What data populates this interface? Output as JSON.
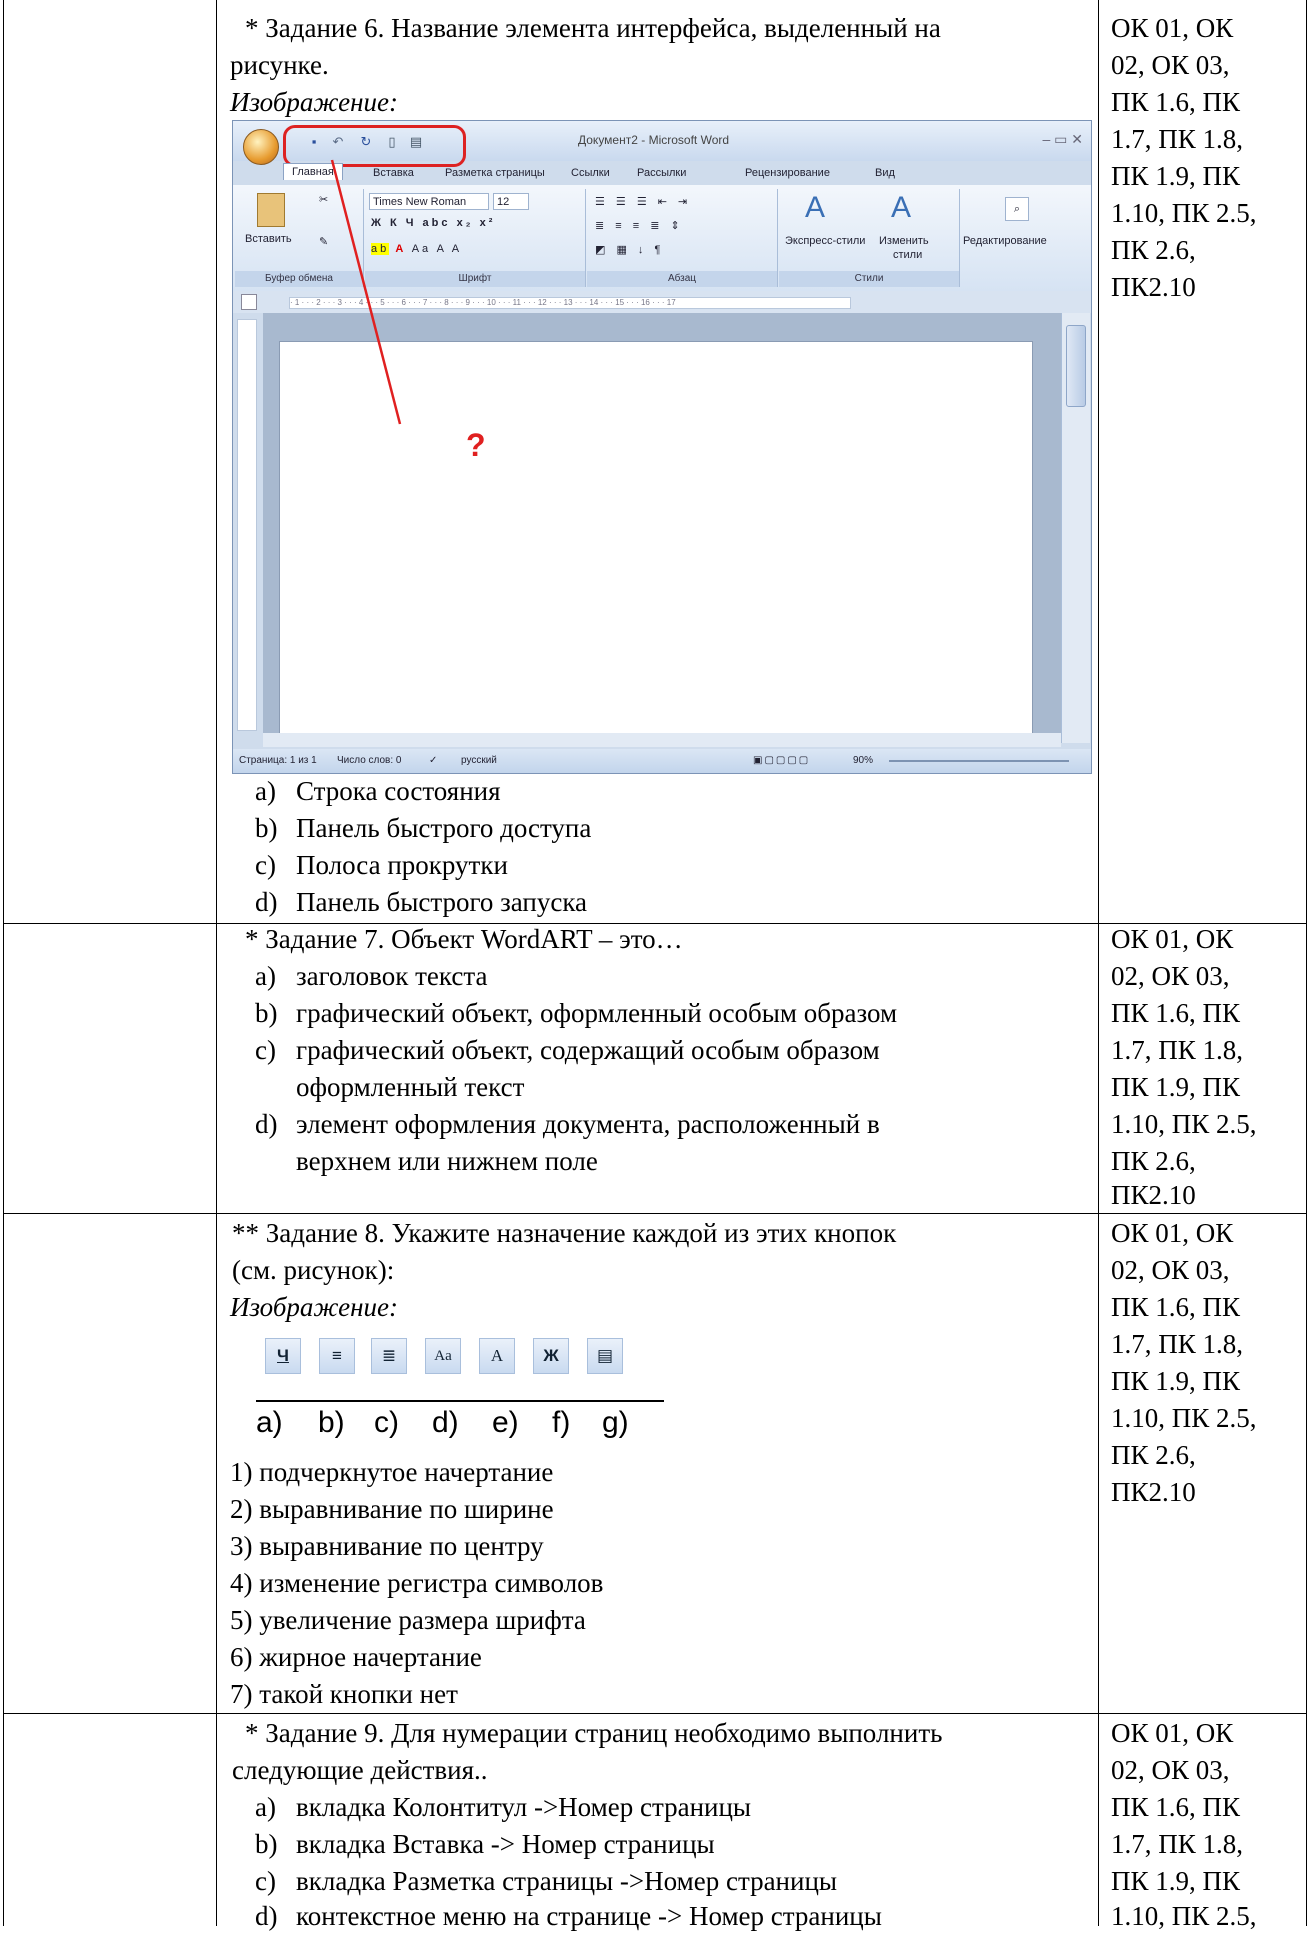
{
  "task6": {
    "question_line1": "* Задание 6. Название элемента интерфейса, выделенный на",
    "question_line2": "рисунке.",
    "image_label": "Изображение:",
    "word": {
      "window_title": "Документ2 - Microsoft Word",
      "tabs": [
        "Главная",
        "Вставка",
        "Разметка страницы",
        "Ссылки",
        "Рассылки",
        "Рецензирование",
        "Вид"
      ],
      "groups": [
        "Буфер обмена",
        "Шрифт",
        "Абзац",
        "Стили",
        "Редактирование"
      ],
      "paste_label": "Вставить",
      "font_name": "Times New Roman",
      "font_size": "12",
      "styles_label1": "Экспресс-стили",
      "styles_label2": "Изменить",
      "styles_label3": "стили",
      "status_page": "Страница: 1 из 1",
      "status_words": "Число слов: 0",
      "status_lang": "русский",
      "zoom": "90%",
      "question_mark": "?"
    },
    "options": [
      {
        "letter": "a)",
        "text": "Строка состояния"
      },
      {
        "letter": "b)",
        "text": "Панель быстрого доступа"
      },
      {
        "letter": "c)",
        "text": "Полоса прокрутки"
      },
      {
        "letter": "d)",
        "text": "Панель быстрого запуска"
      }
    ]
  },
  "task7": {
    "question": "* Задание 7. Объект WordART – это…",
    "options": [
      {
        "letter": "a)",
        "lines": [
          "заголовок текста"
        ]
      },
      {
        "letter": "b)",
        "lines": [
          "графический объект, оформленный особым образом"
        ]
      },
      {
        "letter": "c)",
        "lines": [
          "графический объект, содержащий особым образом",
          "оформленный текст"
        ]
      },
      {
        "letter": "d)",
        "lines": [
          "элемент оформления документа, расположенный в",
          "верхнем или нижнем поле"
        ]
      }
    ]
  },
  "task8": {
    "question_line1": "** Задание 8. Укажите назначение каждой из этих кнопок",
    "question_line2": "(см. рисунок):",
    "image_label": "Изображение:",
    "buttons": [
      "Ч",
      "≡",
      "≣",
      "Aa",
      "A",
      "Ж",
      "▤"
    ],
    "button_letters": [
      "a)",
      "b)",
      "c)",
      "d)",
      "e)",
      "f)",
      "g)"
    ],
    "answers": [
      "1) подчеркнутое начертание",
      "2) выравнивание по ширине",
      "3) выравнивание по центру",
      "4) изменение регистра символов",
      "5) увеличение размера шрифта",
      "6) жирное начертание",
      "7) такой кнопки нет"
    ]
  },
  "task9": {
    "question_line1": "* Задание 9. Для нумерации страниц необходимо выполнить",
    "question_line2": "следующие действия..",
    "options": [
      {
        "letter": "a)",
        "text": "вкладка Колонтитул ->Номер страницы"
      },
      {
        "letter": "b)",
        "text": "вкладка Вставка -> Номер страницы"
      },
      {
        "letter": "c)",
        "text": "вкладка Разметка страницы ->Номер страницы"
      },
      {
        "letter": "d)",
        "text": "контекстное меню на странице -> Номер страницы"
      }
    ]
  },
  "competencies": {
    "full": [
      "ОК 01, ОК",
      "02, ОК 03,",
      "ПК 1.6, ПК",
      "1.7, ПК 1.8,",
      "ПК 1.9, ПК",
      "1.10, ПК 2.5,",
      "ПК 2.6,",
      "ПК2.10"
    ],
    "cut": [
      "ОК 01, ОК",
      "02, ОК 03,",
      "ПК 1.6, ПК",
      "1.7, ПК 1.8,",
      "ПК 1.9, ПК",
      "1.10, ПК 2.5,"
    ]
  }
}
